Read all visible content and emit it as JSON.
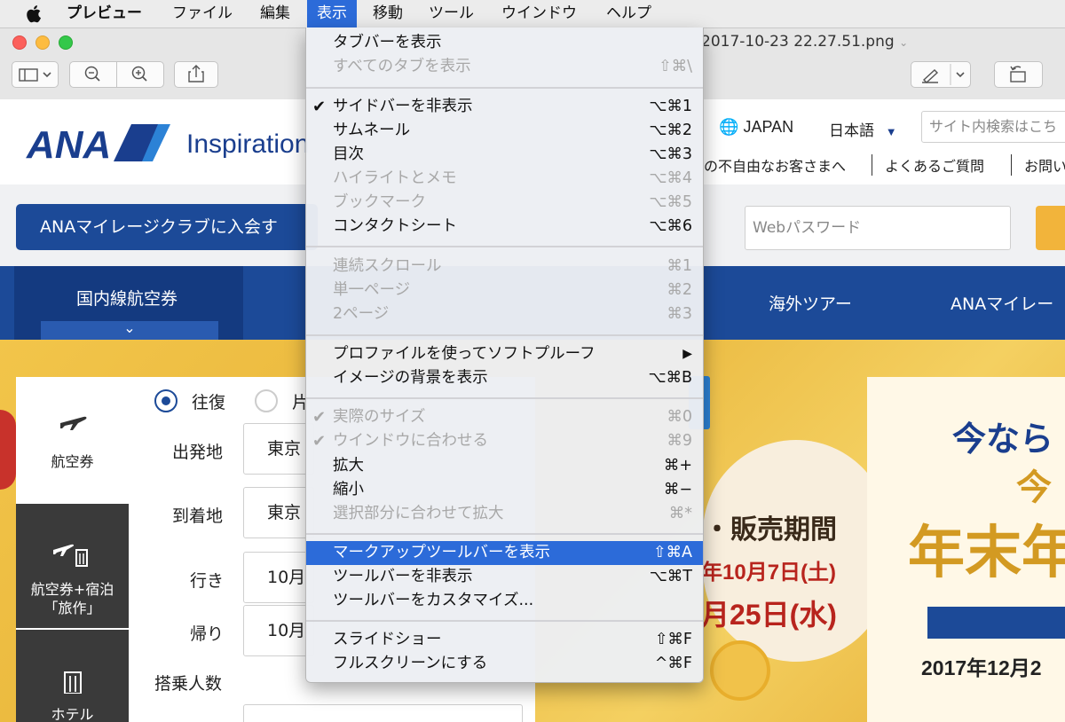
{
  "menubar": {
    "app_name": "プレビュー",
    "items": [
      "ファイル",
      "編集",
      "表示",
      "移動",
      "ツール",
      "ウインドウ",
      "ヘルプ"
    ],
    "active": "表示"
  },
  "window": {
    "title": "2017-10-23 22.27.51.png"
  },
  "view_menu": {
    "tabbar_show": {
      "label": "タブバーを表示",
      "shortcut": ""
    },
    "all_tabs": {
      "label": "すべてのタブを表示",
      "shortcut": "⇧⌘\\"
    },
    "sidebar_hide": {
      "label": "サイドバーを非表示",
      "shortcut": "⌥⌘1",
      "checked": "✔"
    },
    "thumbnails": {
      "label": "サムネール",
      "shortcut": "⌥⌘2"
    },
    "toc": {
      "label": "目次",
      "shortcut": "⌥⌘3"
    },
    "highlights_notes": {
      "label": "ハイライトとメモ",
      "shortcut": "⌥⌘4"
    },
    "bookmarks": {
      "label": "ブックマーク",
      "shortcut": "⌥⌘5"
    },
    "contact_sheet": {
      "label": "コンタクトシート",
      "shortcut": "⌥⌘6"
    },
    "continuous_scroll": {
      "label": "連続スクロール",
      "shortcut": "⌘1"
    },
    "single_page": {
      "label": "単一ページ",
      "shortcut": "⌘2"
    },
    "two_pages": {
      "label": "2ページ",
      "shortcut": "⌘3"
    },
    "soft_proof": {
      "label": "プロファイルを使ってソフトプルーフ",
      "arrow": "▶"
    },
    "image_background": {
      "label": "イメージの背景を表示",
      "shortcut": "⌥⌘B"
    },
    "actual_size": {
      "label": "実際のサイズ",
      "shortcut": "⌘0",
      "checked": "✔"
    },
    "zoom_to_fit": {
      "label": "ウインドウに合わせる",
      "shortcut": "⌘9",
      "checked": "✔"
    },
    "zoom_in": {
      "label": "拡大",
      "shortcut": "⌘+"
    },
    "zoom_out": {
      "label": "縮小",
      "shortcut": "⌘−"
    },
    "zoom_to_selection": {
      "label": "選択部分に合わせて拡大",
      "shortcut": "⌘*"
    },
    "show_markup_toolbar": {
      "label": "マークアップツールバーを表示",
      "shortcut": "⇧⌘A"
    },
    "hide_toolbar": {
      "label": "ツールバーを非表示",
      "shortcut": "⌥⌘T"
    },
    "customize_toolbar": {
      "label": "ツールバーをカスタマイズ...",
      "shortcut": ""
    },
    "slideshow": {
      "label": "スライドショー",
      "shortcut": "⇧⌘F"
    },
    "fullscreen": {
      "label": "フルスクリーンにする",
      "shortcut": "^⌘F"
    }
  },
  "site": {
    "logo": "ANA",
    "logo_sub": "Inspiration",
    "region": "JAPAN",
    "language": "日本語",
    "language_caret": "▼",
    "search_placeholder": "サイト内検索はこち",
    "links": [
      "の不自由なお客さまへ",
      "よくあるご質問",
      "お問い"
    ],
    "join_button": "ANAマイレージクラブに入会す",
    "password_placeholder": "Webパスワード",
    "nav": [
      "国内線航空券",
      "海外ツアー",
      "ANAマイレー"
    ],
    "nav_chevron": "⌄",
    "side_tabs": [
      "航空券",
      "航空券+宿泊\n「旅作」",
      "ホテル"
    ],
    "trip_type": [
      "往復",
      "片"
    ],
    "fields": {
      "departure_label": "出発地",
      "departure_value": "東京",
      "arrival_label": "到着地",
      "arrival_value": "東京",
      "outbound_label": "行き",
      "outbound_value": "10月",
      "return_label": "帰り",
      "return_value": "10月",
      "passengers_label": "搭乗人数"
    },
    "promo": {
      "sale_period": "・販売期間",
      "date1": "年10月7日(土)",
      "date2": "月25日(水)",
      "headline1": "今なら",
      "headline2": "今",
      "headline3": "年末年",
      "end_date": "2017年12月2"
    }
  }
}
